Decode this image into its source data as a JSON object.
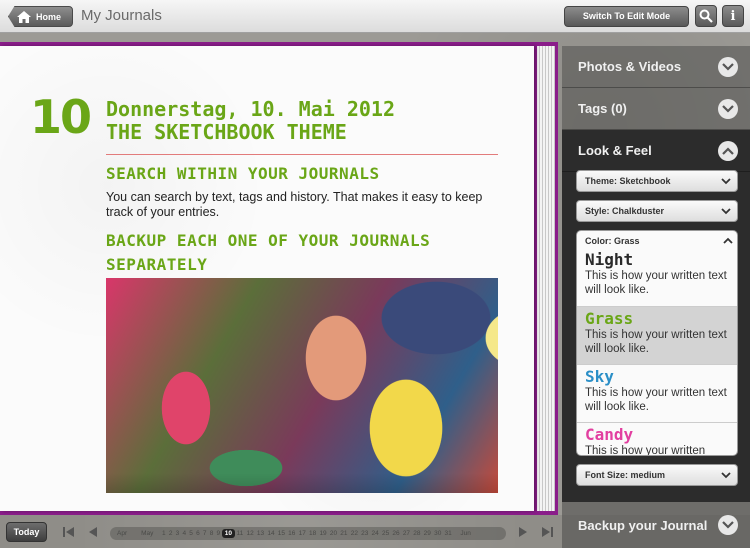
{
  "topbar": {
    "home_label": "Home",
    "title": "My Journals",
    "edit_mode_label": "Switch To Edit Mode",
    "search_icon": "search-icon",
    "info_icon": "info-icon"
  },
  "entry": {
    "day": "10",
    "date": "Donnerstag, 10. Mai 2012",
    "title": "THE SKETCHBOOK THEME",
    "heading_search": "SEARCH WITHIN YOUR JOURNALS",
    "body": "You can search by text, tags and history. That makes it easy to keep track of your entries.",
    "heading_backup": "BACKUP EACH ONE OF YOUR JOURNALS SEPARATELY",
    "accent_color": "#6aa617"
  },
  "panel": {
    "photos_label": "Photos & Videos",
    "tags_label": "Tags (0)",
    "look_label": "Look & Feel",
    "theme_select": "Theme: Sketchbook",
    "style_select": "Style: Chalkduster",
    "color_select": "Color: Grass",
    "font_size_select": "Font Size: medium",
    "backup_label": "Backup your Journal",
    "color_options": [
      {
        "name": "Night",
        "desc": "This is how your written text will look like.",
        "color": "#2a2a2a"
      },
      {
        "name": "Grass",
        "desc": "This is how your written text will look like.",
        "color": "#6aa617"
      },
      {
        "name": "Sky",
        "desc": "This is how your written text will look like.",
        "color": "#2b8fc7"
      },
      {
        "name": "Candy",
        "desc": "This is how your written",
        "color": "#e23fa0"
      }
    ]
  },
  "bottombar": {
    "today_label": "Today",
    "months": [
      "Apr",
      "May",
      "Jun"
    ],
    "days": [
      "1",
      "2",
      "3",
      "4",
      "5",
      "6",
      "7",
      "8",
      "9",
      "10",
      "11",
      "12",
      "13",
      "14",
      "15",
      "16",
      "17",
      "18",
      "19",
      "20",
      "21",
      "22",
      "23",
      "24",
      "25",
      "26",
      "27",
      "28",
      "29",
      "30",
      "31"
    ],
    "current_day": "10"
  }
}
